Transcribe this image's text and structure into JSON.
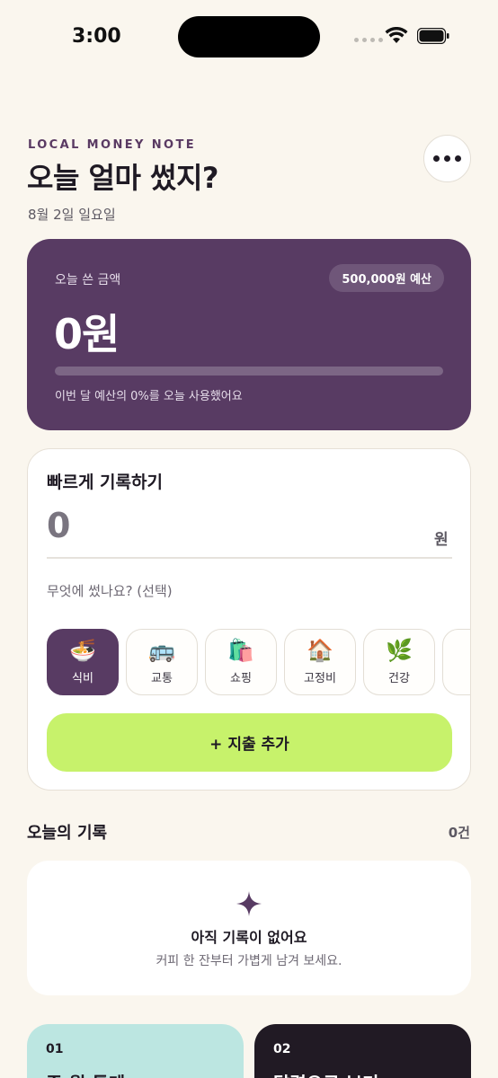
{
  "status_bar": {
    "time": "3:00"
  },
  "header": {
    "eyebrow": "LOCAL MONEY NOTE",
    "title": "오늘 얼마 썼지?",
    "date": "8월 2일 일요일"
  },
  "summary": {
    "label": "오늘 쓴 금액",
    "budget_badge": "500,000원 예산",
    "amount": "0원",
    "progress_fraction": 0,
    "usage_text": "이번 달 예산의 0%를 오늘 사용했어요"
  },
  "quick_entry": {
    "title": "빠르게 기록하기",
    "amount_placeholder": "0",
    "unit": "원",
    "memo_placeholder": "무엇에 썼나요? (선택)",
    "categories": [
      {
        "emoji": "🍜",
        "label": "식비",
        "active": true
      },
      {
        "emoji": "🚌",
        "label": "교통",
        "active": false
      },
      {
        "emoji": "🛍️",
        "label": "쇼핑",
        "active": false
      },
      {
        "emoji": "🏠",
        "label": "고정비",
        "active": false
      },
      {
        "emoji": "🌿",
        "label": "건강",
        "active": false
      }
    ],
    "add_button": "+ 지출 추가"
  },
  "records": {
    "title": "오늘의 기록",
    "count": "0건",
    "empty_title": "아직 기록이 없어요",
    "empty_sub": "커피 한 잔부터 가볍게 남겨 보세요."
  },
  "bottom_cards": [
    {
      "num": "01",
      "title": "주·월 통계"
    },
    {
      "num": "02",
      "title": "달력으로 보기"
    }
  ],
  "colors": {
    "background": "#FAF6EE",
    "primary": "#583B63",
    "accent": "#C7F26B",
    "mint": "#BCE6E1",
    "dark": "#211A24"
  }
}
